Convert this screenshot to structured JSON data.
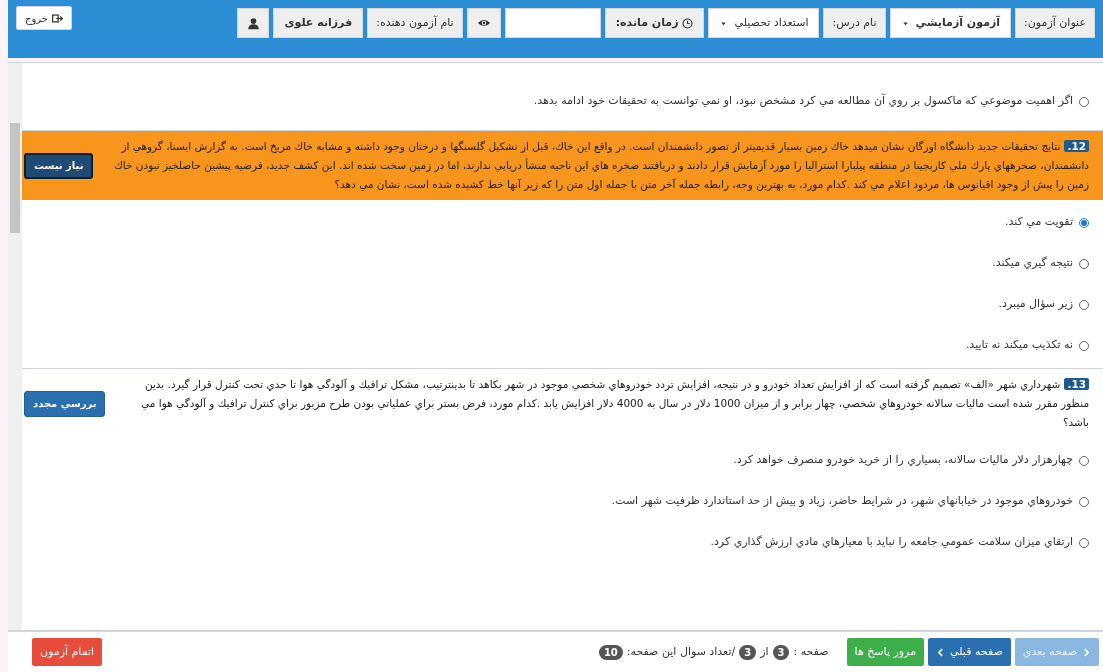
{
  "header": {
    "exit_button": "خروج",
    "items": [
      {
        "kind": "label",
        "text": "عنوان آزمون:"
      },
      {
        "kind": "dropdown",
        "text": "آزمون آزمايشي",
        "bold": true
      },
      {
        "kind": "label",
        "text": "نام درس:"
      },
      {
        "kind": "dropdown",
        "text": "استعداد تحصيلي",
        "bold": false
      },
      {
        "kind": "timer",
        "text": "زمان مانده:"
      },
      {
        "kind": "input"
      },
      {
        "kind": "eye"
      },
      {
        "kind": "label",
        "text": "نام آزمون دهنده:"
      },
      {
        "kind": "value",
        "text": "فرزانه علوی"
      },
      {
        "kind": "user"
      }
    ]
  },
  "questions": [
    {
      "kind": "partial",
      "options": [
        {
          "text": "اگر اهميت موضوعي كه ماكسول بر روي آن مطالعه مي كرد مشخص نبود، او نمي توانست به تحقيقات خود ادامه بدهد.",
          "selected": false
        }
      ]
    },
    {
      "kind": "full",
      "number": "12.",
      "highlighted": true,
      "text": "نتايج تحقيقات جديد دانشگاه اورگان نشان ميدهد خاك زمين بسيار قديميتر از تصور دانشمندان است. در واقع اين خاك، قبل از تشكيل گلسنگها و درختان وجود داشته و مشابه خاك مريخ است. به گزارش ايسنا، گروهي از دانشمندان، صخرههاي پارك ملي كاربجينا در منطقه پيلبارا استراليا را مورد آزمايش قرار دادند و دريافتند صخره هاي اين ناحيه منشأ دريايي ندارند، اما در زمين سخت شده اند. اين كشف جديد، فرضيه پيشين حاصلخيز نبودن خاك زمين را پيش از وجود اقيانوس ها، مردود اعلام مي كند .كدام مورد، به بهترين وجه، رابطه جمله آخر متن با جمله اول متن را كه زير آنها خط كشيده شده است، نشان مي دهد؟",
      "review_button": {
        "label": "نياز نيست",
        "kind": "dark"
      },
      "options": [
        {
          "text": "تقويت مي كند.",
          "selected": true
        },
        {
          "text": "نتيجه گيري ميكند.",
          "selected": false
        },
        {
          "text": "زير سؤال ميبرد.",
          "selected": false
        },
        {
          "text": "نه تكذيب ميكند نه تاييد.",
          "selected": false
        }
      ]
    },
    {
      "kind": "full",
      "number": "13.",
      "highlighted": false,
      "text": "شهرداري شهر «الف» تصميم گرفته است كه از افزايش تعداد خودرو و در نتيجه، افزايش تردد خودروهاي شخصي موجود در شهر بكاهد تا بدينترتيب، مشكل ترافيك و آلودگي هوا تا حدي تحت كنترل قرار گيرد. بدين منظور مقرر شده است ماليات سالانه خودروهاي شخصي، چهار برابر و از ميزان 1000 دلار در سال به 4000 دلار افزايش يابد .كدام مورد، فرض بستر براي عملياتي بودن طرح مزبور براي كنترل ترافيك و آلودگي هوا مي باشد؟",
      "review_button": {
        "label": "بررسي مجدد",
        "kind": "blue"
      },
      "options": [
        {
          "text": "چهارهزار دلار ماليات سالانه، بسياري را از خريد خودرو منصرف خواهد كرد.",
          "selected": false
        },
        {
          "text": "خودروهاي موجود در خيابانهاي شهر، در شرايط حاضر، زياد و بيش از حد استاندارد ظرفيت شهر است.",
          "selected": false
        },
        {
          "text": "ارتقاي ميزان سلامت عمومي جامعه را نبايد با معيارهاي مادي ارزش گذاري كرد.",
          "selected": false
        }
      ]
    }
  ],
  "footer": {
    "next_button": {
      "label": "صفحه بعدي",
      "disabled": true
    },
    "prev_button": {
      "label": "صفحه قبلي",
      "disabled": false
    },
    "review_button": "مرور پاسخ ها",
    "page_label": "صفحه :",
    "page": "3",
    "of_label": "از",
    "total_pages": "3",
    "count_label": "/تعداد سوال اين صفحه:",
    "count": "10",
    "finish_button": "اتمام آزمون"
  }
}
